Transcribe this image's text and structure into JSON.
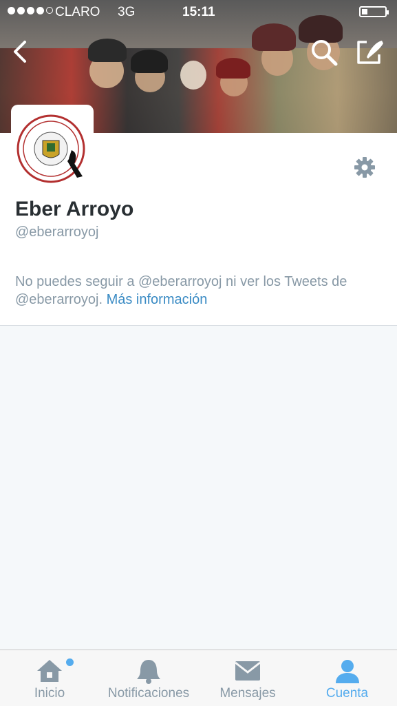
{
  "status_bar": {
    "carrier": "CLARO",
    "network": "3G",
    "time": "15:11",
    "signal_bars": 4,
    "battery_level": 0.25
  },
  "header": {
    "back_icon": "chevron-left-icon",
    "search_icon": "search-icon",
    "compose_icon": "compose-icon"
  },
  "profile": {
    "name": "Eber Arroyo",
    "handle": "@eberarroyoj",
    "protected_text": "No puedes seguir a @eberarroyoj ni ver los Tweets de @eberarroyoj.",
    "more_info_link": "Más información",
    "settings_icon": "gear-icon"
  },
  "tabbar": {
    "items": [
      {
        "label": "Inicio",
        "icon": "home-icon",
        "active": false,
        "has_badge": true
      },
      {
        "label": "Notificaciones",
        "icon": "bell-icon",
        "active": false,
        "has_badge": false
      },
      {
        "label": "Mensajes",
        "icon": "envelope-icon",
        "active": false,
        "has_badge": false
      },
      {
        "label": "Cuenta",
        "icon": "person-icon",
        "active": true,
        "has_badge": false
      }
    ]
  },
  "colors": {
    "accent": "#55acee",
    "link": "#3a8bc4",
    "text_primary": "#292f33",
    "text_secondary": "#8899a6",
    "background": "#f5f8fa"
  }
}
